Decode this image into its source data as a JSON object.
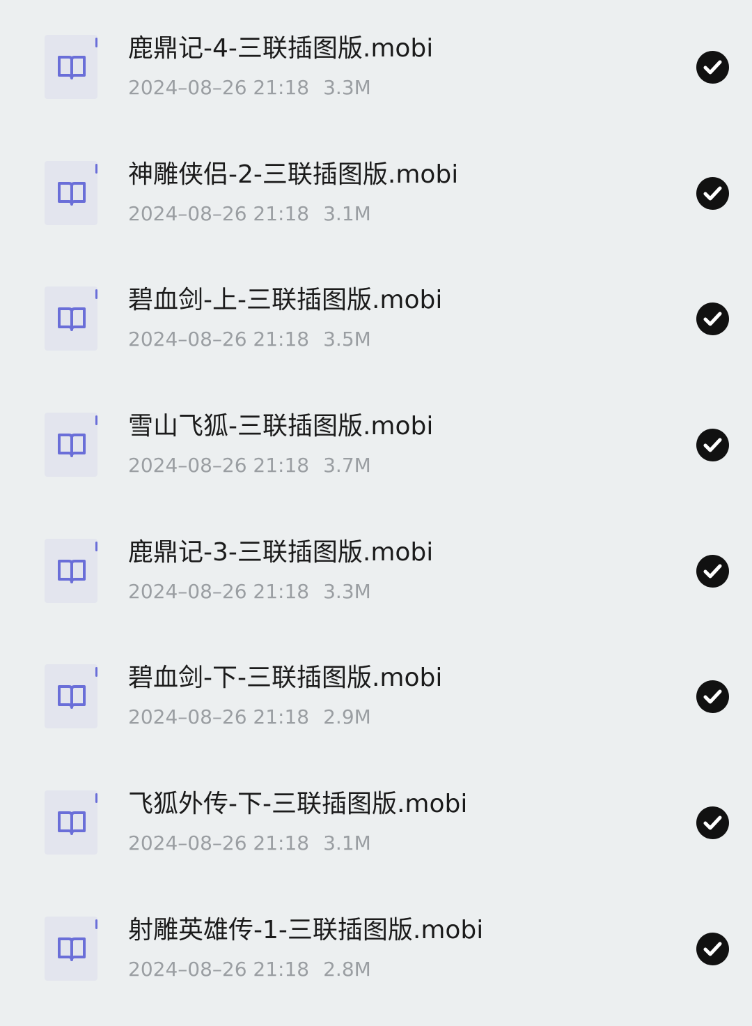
{
  "files": [
    {
      "name": "鹿鼎记-4-三联插图版.mobi",
      "date": "2024–08–26 21:18",
      "size": "3.3M",
      "icon": "book-icon",
      "selected": true
    },
    {
      "name": "神雕侠侣-2-三联插图版.mobi",
      "date": "2024–08–26 21:18",
      "size": "3.1M",
      "icon": "book-icon",
      "selected": true
    },
    {
      "name": "碧血剑-上-三联插图版.mobi",
      "date": "2024–08–26 21:18",
      "size": "3.5M",
      "icon": "book-icon",
      "selected": true
    },
    {
      "name": "雪山飞狐-三联插图版.mobi",
      "date": "2024–08–26 21:18",
      "size": "3.7M",
      "icon": "book-icon",
      "selected": true
    },
    {
      "name": "鹿鼎记-3-三联插图版.mobi",
      "date": "2024–08–26 21:18",
      "size": "3.3M",
      "icon": "book-icon",
      "selected": true
    },
    {
      "name": "碧血剑-下-三联插图版.mobi",
      "date": "2024–08–26 21:18",
      "size": "2.9M",
      "icon": "book-icon",
      "selected": true
    },
    {
      "name": "飞狐外传-下-三联插图版.mobi",
      "date": "2024–08–26 21:18",
      "size": "3.1M",
      "icon": "book-icon",
      "selected": true
    },
    {
      "name": "射雕英雄传-1-三联插图版.mobi",
      "date": "2024–08–26 21:18",
      "size": "2.8M",
      "icon": "book-icon",
      "selected": true
    }
  ],
  "colors": {
    "background": "#eceff0",
    "icon_bg": "#e3e5ee",
    "icon_accent": "#6a6ed8",
    "title_text": "#1b1b1b",
    "meta_text": "#9a9ea2",
    "check_bg": "#111111"
  }
}
